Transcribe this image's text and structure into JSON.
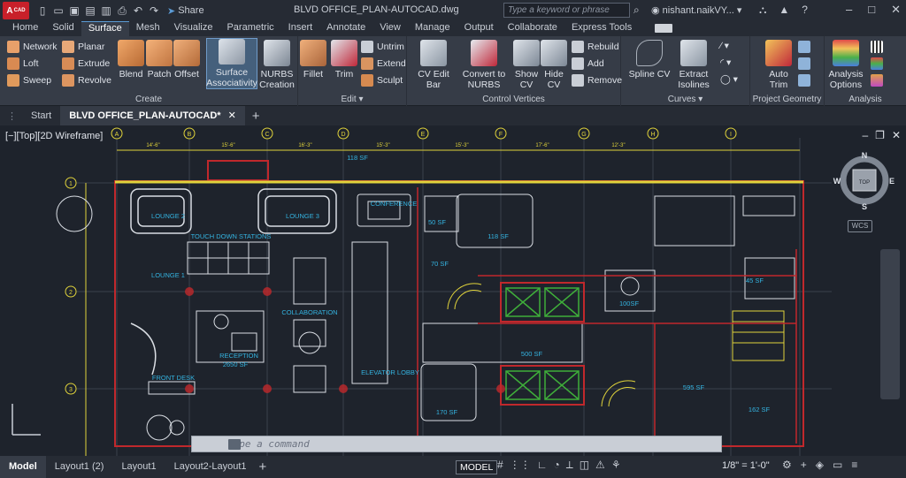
{
  "title_bar": {
    "logo_text": "A",
    "logo_badge": "CAD",
    "share_label": "Share",
    "document_title": "BLVD OFFICE_PLAN-AUTOCAD.dwg",
    "search_placeholder": "Type a keyword or phrase",
    "user_name": "nishant.naikVY..."
  },
  "ribbon_tabs": [
    {
      "label": "Home"
    },
    {
      "label": "Solid"
    },
    {
      "label": "Surface",
      "active": true
    },
    {
      "label": "Mesh"
    },
    {
      "label": "Visualize"
    },
    {
      "label": "Parametric"
    },
    {
      "label": "Insert"
    },
    {
      "label": "Annotate"
    },
    {
      "label": "View"
    },
    {
      "label": "Manage"
    },
    {
      "label": "Output"
    },
    {
      "label": "Collaborate"
    },
    {
      "label": "Express Tools"
    }
  ],
  "ribbon": {
    "create": {
      "title": "Create",
      "network": "Network",
      "planar": "Planar",
      "loft": "Loft",
      "extrude": "Extrude",
      "sweep": "Sweep",
      "revolve": "Revolve",
      "blend": "Blend",
      "patch": "Patch",
      "offset": "Offset",
      "surface_assoc_1": "Surface",
      "surface_assoc_2": "Associativity",
      "nurbs_1": "NURBS",
      "nurbs_2": "Creation"
    },
    "edit": {
      "title": "Edit",
      "fillet": "Fillet",
      "trim": "Trim",
      "untrim": "Untrim",
      "extend": "Extend",
      "sculpt": "Sculpt"
    },
    "control_vertices": {
      "title": "Control Vertices",
      "cv_edit_bar": "CV Edit Bar",
      "convert_1": "Convert to",
      "convert_2": "NURBS",
      "show_1": "Show",
      "show_2": "CV",
      "hide_1": "Hide",
      "hide_2": "CV",
      "rebuild": "Rebuild",
      "add": "Add",
      "remove": "Remove"
    },
    "curves": {
      "title": "Curves",
      "spline_cv": "Spline CV",
      "extract_1": "Extract",
      "extract_2": "Isolines"
    },
    "project_geometry": {
      "title": "Project Geometry",
      "auto_1": "Auto",
      "auto_2": "Trim"
    },
    "analysis": {
      "title": "Analysis",
      "options_1": "Analysis",
      "options_2": "Options"
    }
  },
  "doc_tabs": {
    "start": "Start",
    "active": "BLVD OFFICE_PLAN-AUTOCAD*"
  },
  "viewport": {
    "label": "[−][Top][2D Wireframe]",
    "viewcube_top": "TOP",
    "compass_n": "N",
    "compass_s": "S",
    "compass_e": "E",
    "compass_w": "W",
    "wcs": "WCS"
  },
  "plan": {
    "labels": [
      "LOUNGE 2",
      "LOUNGE 3",
      "CONFERENCE",
      "TOUCH DOWN STATIONS",
      "LOUNGE 1",
      "COLLABORATION",
      "RECEPTION",
      "2650 SF",
      "FRONT DESK",
      "ELEVATOR LOBBY",
      "118 SF",
      "50 SF",
      "118 SF",
      "70 SF",
      "500 SF",
      "100SF",
      "595 SF",
      "170 SF",
      "45 SF",
      "162 SF"
    ],
    "grid_markers": [
      "A",
      "B",
      "C",
      "D",
      "E",
      "F",
      "G",
      "H",
      "I",
      "1",
      "2",
      "3"
    ],
    "dimensions": [
      "14'-6\"",
      "15'-6\"",
      "16'-3\"",
      "15'-3\"",
      "15'-3\"",
      "17'-6\"",
      "12'-3\""
    ]
  },
  "command_line": {
    "placeholder": "Type a command"
  },
  "layout_tabs": {
    "model": "Model",
    "layout1_2": "Layout1 (2)",
    "layout1": "Layout1",
    "layout2": "Layout2-Layout1"
  },
  "status": {
    "model_label": "MODEL",
    "scale": "1/8\" = 1'-0\""
  },
  "colors": {
    "drawing_bg": "#1e232c",
    "wall_red": "#c0282c",
    "furniture_white": "#d9dde3",
    "label_cyan": "#34b3e0",
    "accent_yellow": "#e0d33b",
    "elevator_green": "#3fae3a"
  }
}
